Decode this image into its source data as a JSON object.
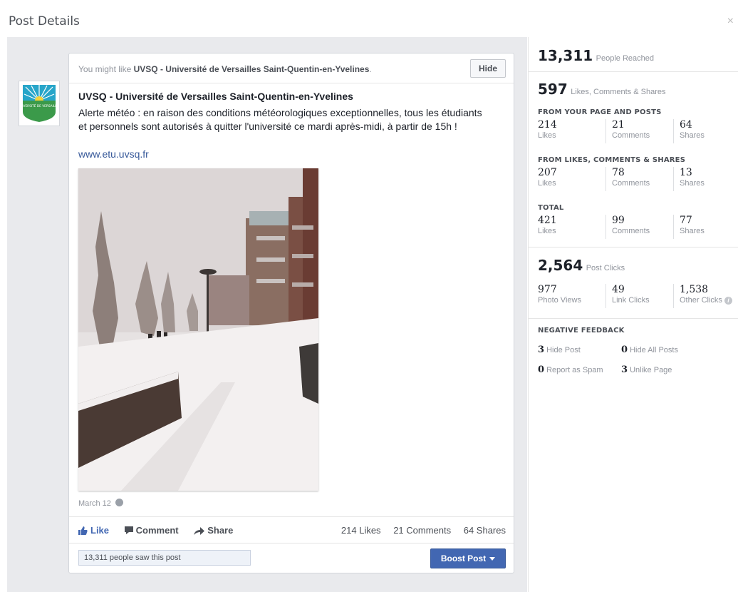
{
  "dialog": {
    "title": "Post Details",
    "close_glyph": "×"
  },
  "post": {
    "might_like_prefix": "You might like",
    "page_name": "UVSQ - Université de Versailles Saint-Quentin-en-Yvelines",
    "might_like_suffix": ".",
    "hide_label": "Hide",
    "text": "Alerte météo : en raison des conditions météorologiques exceptionnelles, tous les étudiants et personnels sont autorisés à quitter l'université ce mardi après-midi, à partir de 15h !",
    "link": "www.etu.uvsq.fr",
    "date": "March 12",
    "actions": {
      "like": "Like",
      "comment": "Comment",
      "share": "Share"
    },
    "counts": {
      "likes": "214 Likes",
      "comments": "21 Comments",
      "shares": "64 Shares"
    },
    "saw": "13,311 people saw this post",
    "boost_label": "Boost Post",
    "logo_text": "UNIVERSITÉ DE VERSAILLES"
  },
  "insights": {
    "reached": {
      "value": "13,311",
      "label": "People Reached"
    },
    "engagement": {
      "value": "597",
      "label": "Likes, Comments & Shares"
    },
    "groups": [
      {
        "title": "FROM YOUR PAGE AND POSTS",
        "likes": "214",
        "comments": "21",
        "shares": "64"
      },
      {
        "title": "FROM LIKES, COMMENTS & SHARES",
        "likes": "207",
        "comments": "78",
        "shares": "13"
      },
      {
        "title": "TOTAL",
        "likes": "421",
        "comments": "99",
        "shares": "77"
      }
    ],
    "labels": {
      "likes": "Likes",
      "comments": "Comments",
      "shares": "Shares"
    },
    "clicks": {
      "value": "2,564",
      "label": "Post Clicks"
    },
    "click_breakdown": [
      {
        "value": "977",
        "label": "Photo Views"
      },
      {
        "value": "49",
        "label": "Link Clicks"
      },
      {
        "value": "1,538",
        "label": "Other Clicks"
      }
    ],
    "negative": {
      "title": "NEGATIVE FEEDBACK",
      "hide_post": {
        "value": "3",
        "label": "Hide Post"
      },
      "hide_all": {
        "value": "0",
        "label": "Hide All Posts"
      },
      "spam": {
        "value": "0",
        "label": "Report as Spam"
      },
      "unlike": {
        "value": "3",
        "label": "Unlike Page"
      }
    }
  }
}
